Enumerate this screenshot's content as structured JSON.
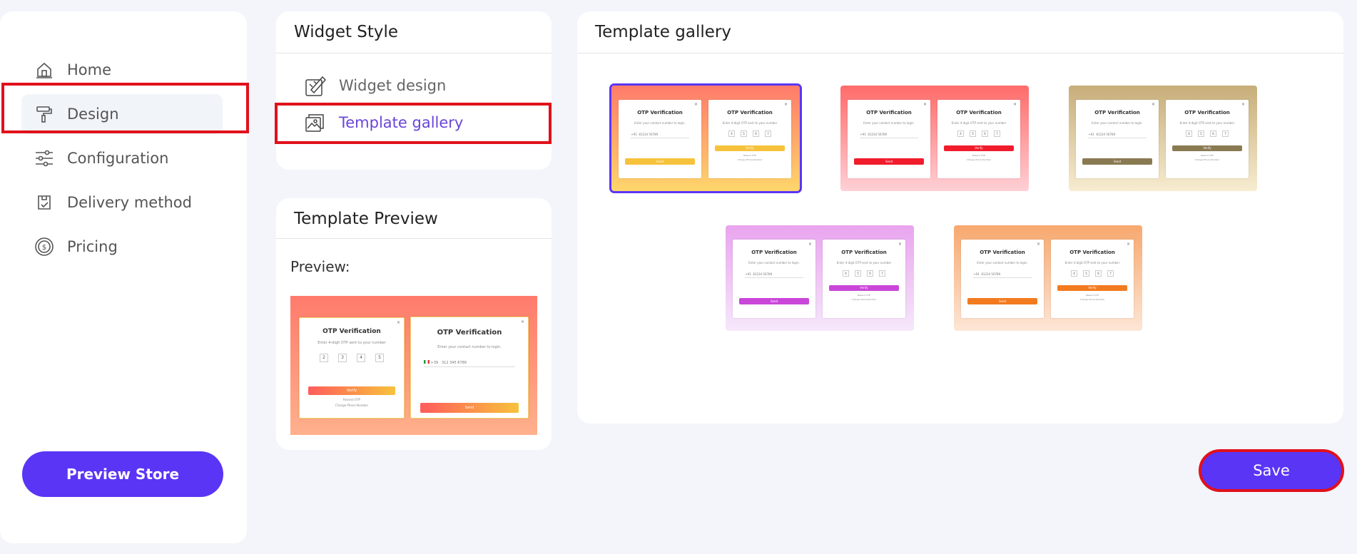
{
  "sidebar": {
    "items": [
      {
        "label": "Home",
        "icon": "home-icon"
      },
      {
        "label": "Design",
        "icon": "paint-roller-icon"
      },
      {
        "label": "Configuration",
        "icon": "sliders-icon"
      },
      {
        "label": "Delivery method",
        "icon": "package-check-icon"
      },
      {
        "label": "Pricing",
        "icon": "dollar-coin-icon"
      }
    ],
    "active": "Design",
    "preview_store_label": "Preview Store"
  },
  "widget_style": {
    "title": "Widget Style",
    "items": [
      {
        "label": "Widget design",
        "icon": "brush-design-icon"
      },
      {
        "label": "Template gallery",
        "icon": "gallery-icon"
      }
    ],
    "active": "Template gallery"
  },
  "template_preview": {
    "title": "Template Preview",
    "preview_label": "Preview:",
    "left_panel": {
      "title": "OTP Verification",
      "subtitle": "Enter 4-digit OTP sent to your number",
      "digits": [
        "2",
        "3",
        "4",
        "5"
      ],
      "button": "Verify",
      "resend": "Resend OTP",
      "change": "Change Phone Number"
    },
    "right_panel": {
      "title": "OTP Verification",
      "subtitle": "Enter your contact number to login.",
      "code": "+39",
      "phone": "312 345 6789",
      "button": "Send"
    }
  },
  "template_gallery": {
    "title": "Template gallery",
    "templates": [
      {
        "name": "sunset",
        "bg": "#ff7b6b",
        "bg2": "#ffd66b",
        "accent": "#f7c23b",
        "selected": true
      },
      {
        "name": "coral",
        "bg": "#ff6b6b",
        "bg2": "#ffd0d6",
        "accent": "#f01c2c",
        "selected": false
      },
      {
        "name": "sand",
        "bg": "#c7ae7a",
        "bg2": "#f7ecd0",
        "accent": "#8a7a52",
        "selected": false
      },
      {
        "name": "lilac",
        "bg": "#e9a4ee",
        "bg2": "#f6e8fb",
        "accent": "#c946d8",
        "selected": false
      },
      {
        "name": "peach",
        "bg": "#f7a86e",
        "bg2": "#fde6d6",
        "accent": "#f27a1f",
        "selected": false
      }
    ],
    "mini_left": {
      "title": "OTP Verification",
      "subtitle": "Enter your contact number to login.",
      "code": "+91",
      "phone": "81234 56789",
      "button": "Send"
    },
    "mini_right": {
      "title": "OTP Verification",
      "subtitle": "Enter 4-digit OTP sent to your number",
      "digits": [
        "4",
        "5",
        "6",
        "7"
      ],
      "button": "Verify",
      "resend": "Resend OTP",
      "change": "Change Phone Number"
    }
  },
  "save_label": "Save",
  "colors": {
    "primary": "#5a35f5",
    "highlight": "#e0111b",
    "active_text": "#6a45d8"
  }
}
